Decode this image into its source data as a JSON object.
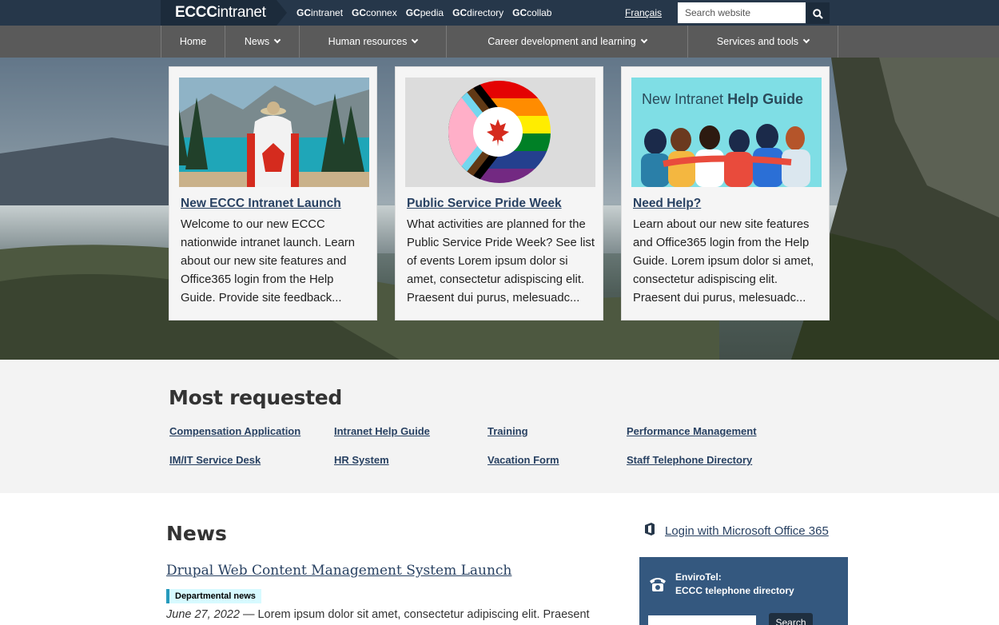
{
  "topbar": {
    "brand_bold": "ECCC",
    "brand_light": "intranet",
    "gc_links": [
      {
        "prefix": "GC",
        "suffix": "intranet"
      },
      {
        "prefix": "GC",
        "suffix": "connex"
      },
      {
        "prefix": "GC",
        "suffix": "pedia"
      },
      {
        "prefix": "GC",
        "suffix": "directory"
      },
      {
        "prefix": "GC",
        "suffix": "collab"
      }
    ],
    "language_link": "Français",
    "search_placeholder": "Search website"
  },
  "nav": {
    "items": [
      {
        "label": "Home"
      },
      {
        "label": "News"
      },
      {
        "label": "Human resources"
      },
      {
        "label": "Career development and learning"
      },
      {
        "label": "Services and tools"
      }
    ]
  },
  "cards": [
    {
      "title": "New ECCC Intranet Launch",
      "body": "Welcome to our new ECCC nationwide intranet launch. Learn about our new site features and Office365 login from the Help Guide. Provide site feedback..."
    },
    {
      "title": "Public Service Pride Week",
      "body": "What activities are planned for the Public Service Pride Week? See list of events Lorem ipsum dolor si amet, consectetur adispiscing elit. Praesent dui purus, melesuadc..."
    },
    {
      "title": "Need Help?",
      "image_caption_light": "New Intranet ",
      "image_caption_bold": "Help Guide",
      "body": "Learn about our new site features and Office365 login from the Help Guide. Lorem ipsum dolor si amet, consectetur adispiscing elit. Praesent dui purus, melesuadc..."
    }
  ],
  "most_requested": {
    "title": "Most requested",
    "links": [
      "Compensation Application",
      "Intranet Help Guide",
      "Training",
      "Performance Management",
      "IM/IT Service Desk",
      "HR System",
      "Vacation Form",
      "Staff Telephone Directory"
    ]
  },
  "news": {
    "title": "News",
    "article_title": "Drupal Web Content Management System Launch",
    "tag": "Departmental news",
    "date": "June 27, 2022",
    "dash": " — ",
    "excerpt": "Lorem ipsum dolor sit amet, consectetur adipiscing elit. Praesent"
  },
  "sidebar": {
    "o365_link": "Login with Microsoft Office 365",
    "envirotel_line1": "EnviroTel:",
    "envirotel_line2": "ECCC telephone directory",
    "envirotel_button": "Search"
  },
  "colors": {
    "topbar": "#26374a",
    "nav": "#5a5a5a",
    "link": "#284162",
    "envirotel_panel": "#34587f",
    "tag_bg": "#d7faff"
  },
  "icons": [
    "search-icon",
    "chevron-down-icon",
    "office365-icon",
    "phone-icon"
  ]
}
